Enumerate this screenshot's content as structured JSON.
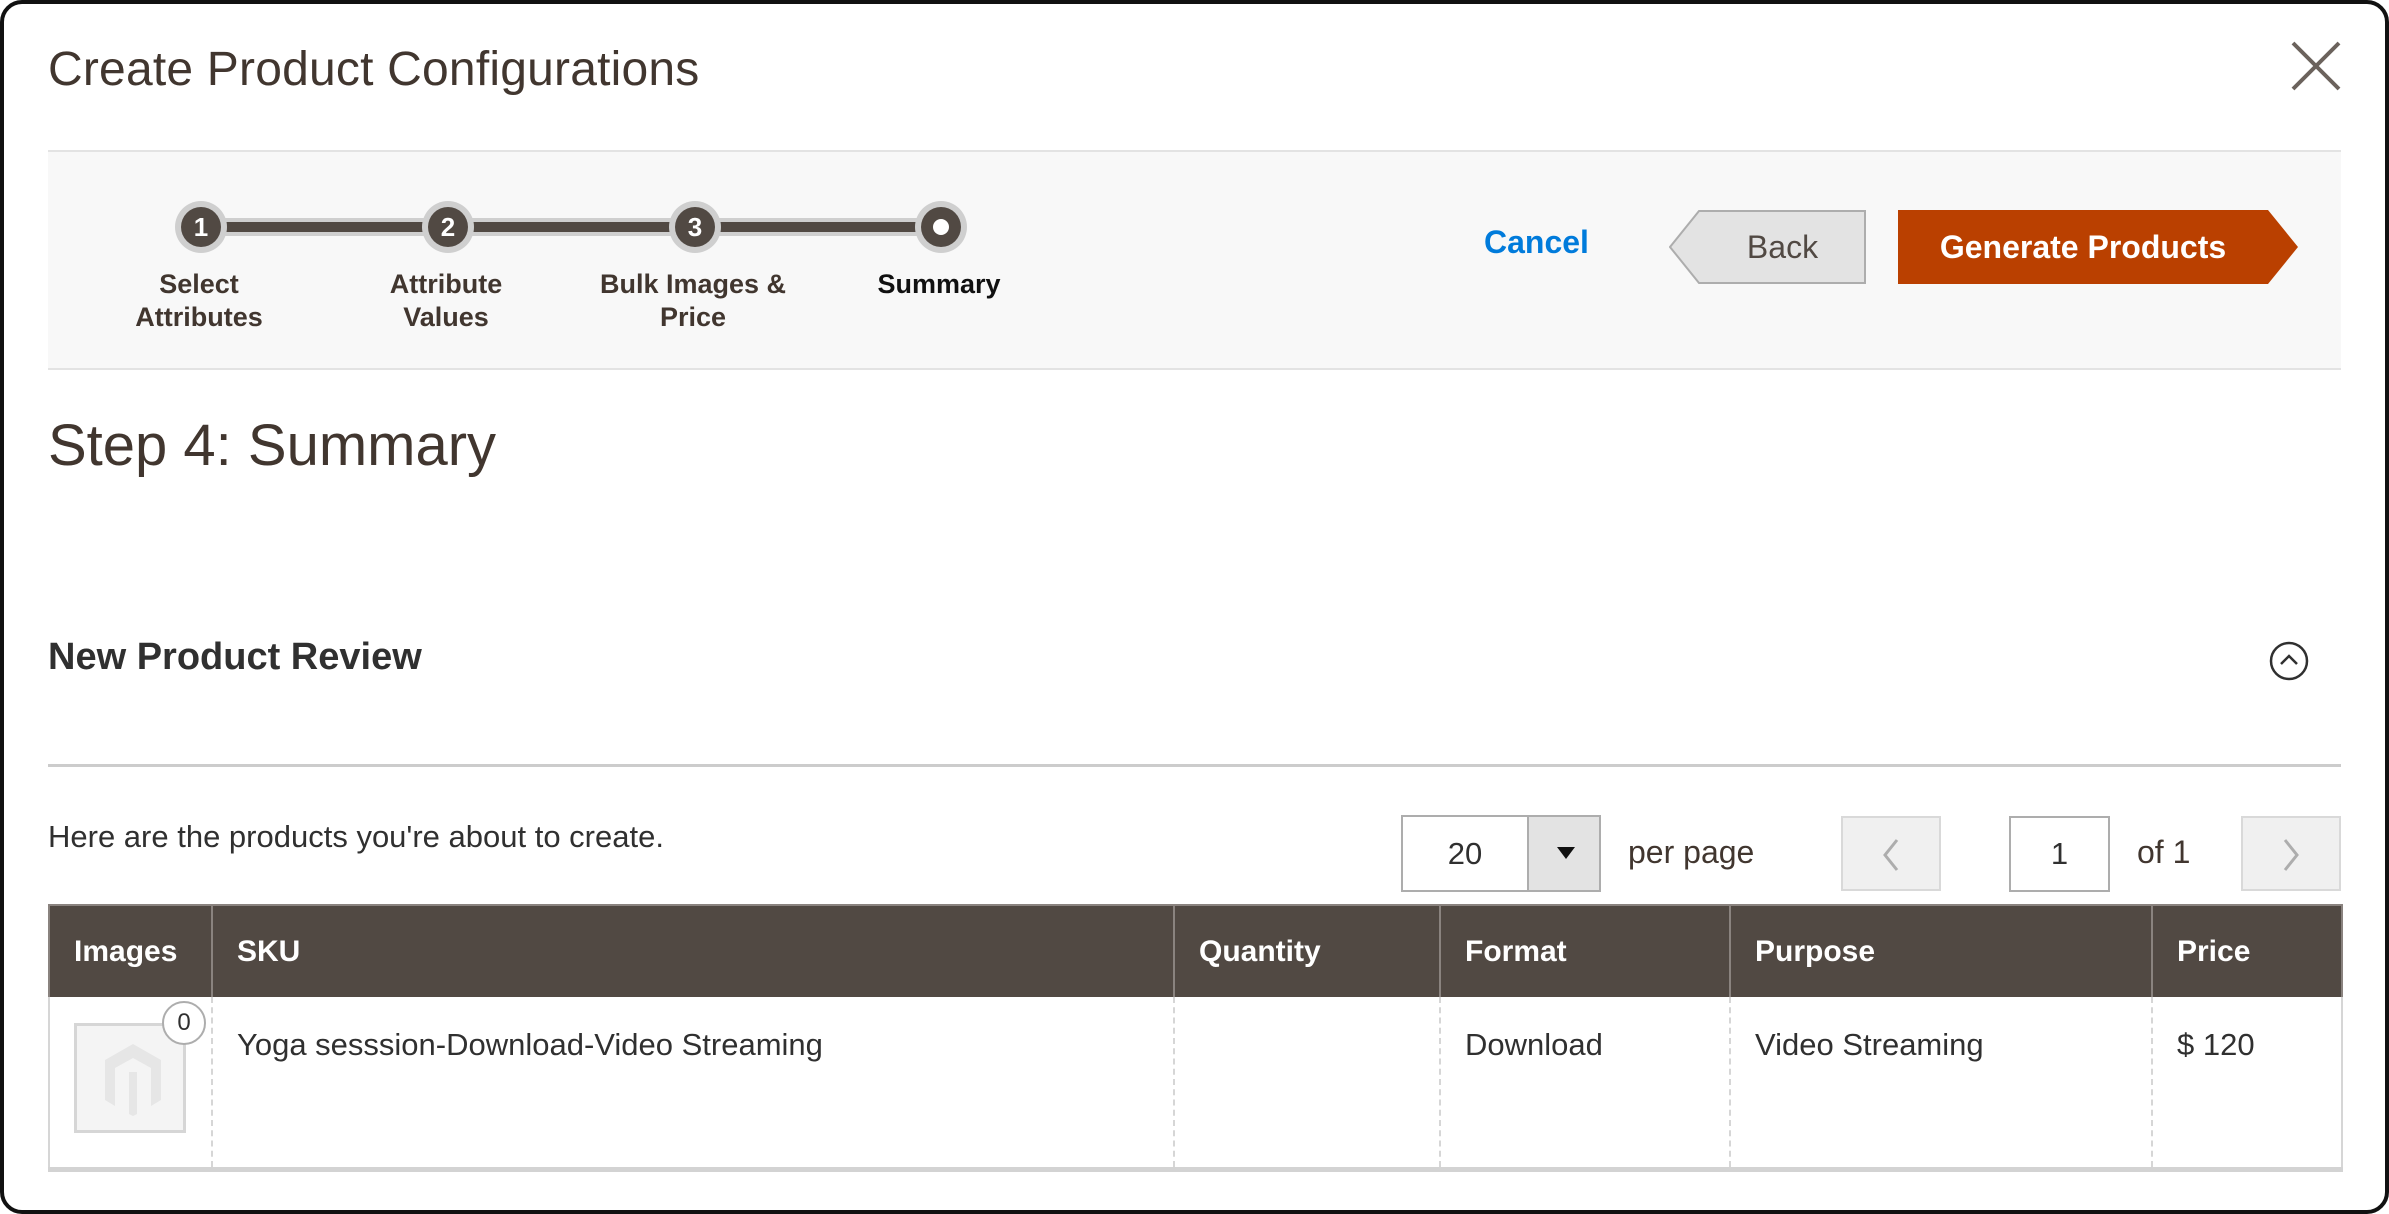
{
  "modal": {
    "title": "Create Product Configurations",
    "close_icon": "close-icon"
  },
  "wizard": {
    "steps": [
      {
        "number": "1",
        "label_line1": "Select",
        "label_line2": "Attributes",
        "state": "complete"
      },
      {
        "number": "2",
        "label_line1": "Attribute",
        "label_line2": "Values",
        "state": "complete"
      },
      {
        "number": "3",
        "label_line1": "Bulk Images &",
        "label_line2": "Price",
        "state": "complete"
      },
      {
        "number": "",
        "label_line1": "Summary",
        "label_line2": "",
        "state": "active"
      }
    ],
    "cancel_label": "Cancel",
    "back_label": "Back",
    "generate_label": "Generate Products",
    "colors": {
      "primary": "#eb5202",
      "primary_bg": "#ba4000",
      "link": "#007bdb",
      "step": "#514943"
    }
  },
  "content": {
    "step_title": "Step 4: Summary",
    "section_title": "New Product Review",
    "collapse_icon": "chevron-up-circle-icon",
    "intro_text": "Here are the products you're about to create."
  },
  "pager": {
    "per_page_value": "20",
    "per_page_label": "per page",
    "current_page": "1",
    "of_label": "of 1",
    "prev_icon": "chevron-left-icon",
    "next_icon": "chevron-right-icon"
  },
  "table": {
    "columns": [
      "Images",
      "SKU",
      "Quantity",
      "Format",
      "Purpose",
      "Price"
    ],
    "rows": [
      {
        "image_count": "0",
        "sku": "Yoga sesssion-Download-Video Streaming",
        "quantity": "",
        "format": "Download",
        "purpose": "Video Streaming",
        "price": "$ 120"
      }
    ]
  }
}
